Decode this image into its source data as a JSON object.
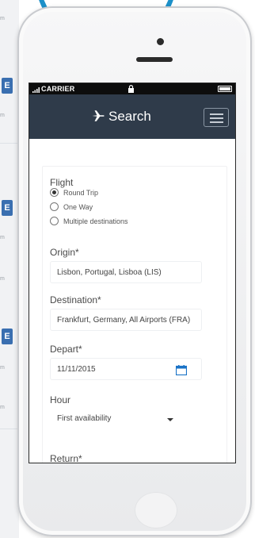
{
  "status_bar": {
    "carrier": "CARRIER"
  },
  "header": {
    "title": "Search",
    "plane_icon": "airplane-icon",
    "menu_icon": "hamburger-menu-icon"
  },
  "form": {
    "flight_label": "Flight",
    "trip_options": [
      {
        "label": "Round Trip",
        "checked": true
      },
      {
        "label": "One Way",
        "checked": false
      },
      {
        "label": "Multiple destinations",
        "checked": false
      }
    ],
    "origin_label": "Origin*",
    "origin_value": "Lisbon, Portugal, Lisboa (LIS)",
    "destination_label": "Destination*",
    "destination_value": "Frankfurt, Germany, All Airports (FRA)",
    "depart_label": "Depart*",
    "depart_value": "11/11/2015",
    "calendar_icon": "calendar-icon",
    "hour_label": "Hour",
    "hour_value": "First availability",
    "return_label": "Return*"
  },
  "colors": {
    "navbar": "#2f3b4a",
    "accent_ring": "#1c90c9",
    "calendar": "#1a73c7",
    "strip_tab": "#3a6fb0"
  },
  "background_strip": {
    "tab_letter": "E"
  }
}
